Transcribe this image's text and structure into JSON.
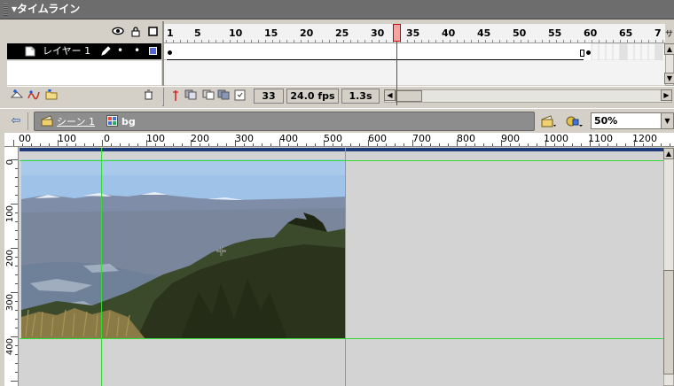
{
  "timeline": {
    "title": "タイムライン",
    "frame_numbers": [
      "1",
      "5",
      "10",
      "15",
      "20",
      "25",
      "30",
      "35",
      "40",
      "45",
      "50",
      "55",
      "60",
      "65",
      "7"
    ],
    "trailing_header": "サ",
    "layer": {
      "name": "レイヤー 1",
      "dot1": "•",
      "dot2": "•"
    },
    "current_frame": "33",
    "frame_rate": "24.0 fps",
    "elapsed": "1.3s"
  },
  "scene": {
    "scene_label": "シーン 1",
    "symbol_label": "bg",
    "zoom": "50%"
  },
  "hruler": [
    "00",
    "100",
    "0",
    "100",
    "200",
    "300",
    "400",
    "500",
    "600",
    "700",
    "800",
    "900",
    "1000",
    "1100",
    "1200"
  ],
  "vruler": [
    "0",
    "100",
    "200",
    "300",
    "400"
  ],
  "colors": {
    "panel_title": "#6d6d6d",
    "playhead": "#d02020",
    "stage_bg": "#d3d3d3",
    "guide": "#33dd33",
    "sky": "#9fc2e8"
  }
}
